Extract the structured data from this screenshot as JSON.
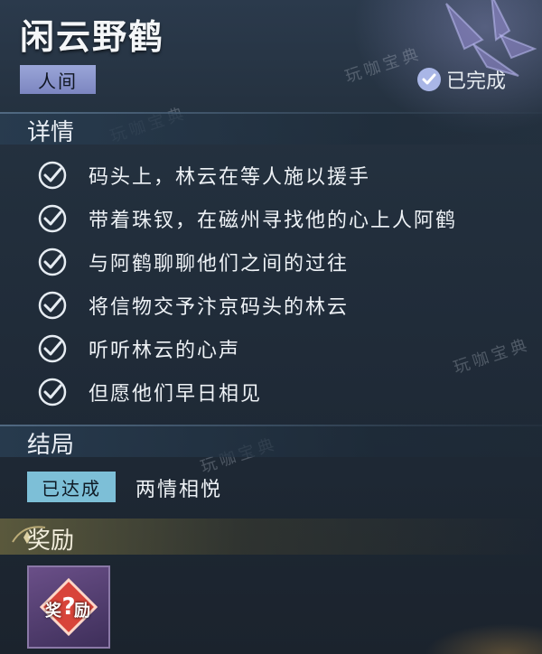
{
  "quest": {
    "title": "闲云野鹤",
    "category": "人间",
    "status": "已完成"
  },
  "details": {
    "heading": "详情",
    "tasks": [
      "码头上，林云在等人施以援手",
      "带着珠钗，在磁州寻找他的心上人阿鹤",
      "与阿鹤聊聊他们之间的过往",
      "将信物交予汴京码头的林云",
      "听听林云的心声",
      "但愿他们早日相见"
    ]
  },
  "ending": {
    "heading": "结局",
    "badge": "已达成",
    "result": "两情相悦"
  },
  "reward": {
    "heading": "奖励",
    "item_char_1": "奖",
    "item_char_2": "励"
  },
  "watermark": "玩咖宝典",
  "colors": {
    "accent_purple": "#9aa6d8",
    "ending_badge": "#7dbfd7",
    "check": "#a9b6e6"
  }
}
